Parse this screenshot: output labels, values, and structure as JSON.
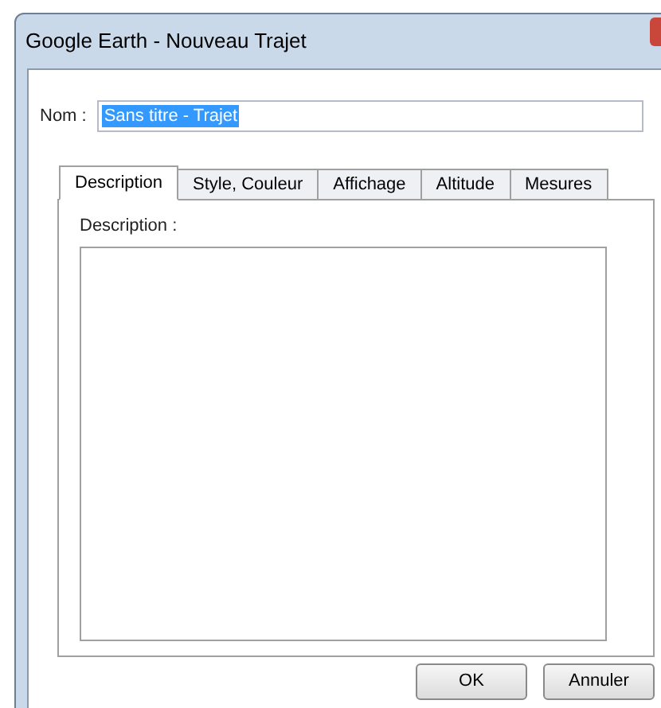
{
  "window": {
    "title": "Google Earth - Nouveau Trajet"
  },
  "name_field": {
    "label": "Nom :",
    "value": "Sans titre - Trajet",
    "selected": true
  },
  "tabs": [
    {
      "label": "Description",
      "selected": true
    },
    {
      "label": "Style, Couleur",
      "selected": false
    },
    {
      "label": "Affichage",
      "selected": false
    },
    {
      "label": "Altitude",
      "selected": false
    },
    {
      "label": "Mesures",
      "selected": false
    }
  ],
  "description": {
    "label": "Description :"
  },
  "buttons": [
    "OK",
    "Annuler"
  ]
}
